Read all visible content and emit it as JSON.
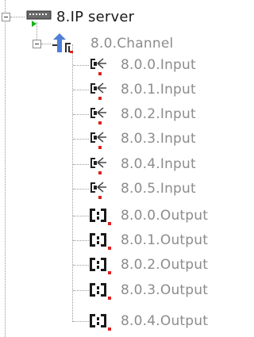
{
  "tree": {
    "server": {
      "label": "8.IP server",
      "icon": "network-server-icon"
    },
    "channel": {
      "label": "8.0.Channel",
      "icon": "channel-antenna-icon"
    },
    "items": [
      {
        "label": "8.0.0.Input",
        "icon": "input-connector-icon"
      },
      {
        "label": "8.0.1.Input",
        "icon": "input-connector-icon"
      },
      {
        "label": "8.0.2.Input",
        "icon": "input-connector-icon"
      },
      {
        "label": "8.0.3.Input",
        "icon": "input-connector-icon"
      },
      {
        "label": "8.0.4.Input",
        "icon": "input-connector-icon"
      },
      {
        "label": "8.0.5.Input",
        "icon": "input-connector-icon"
      },
      {
        "label": "8.0.0.Output",
        "icon": "output-bracket-icon"
      },
      {
        "label": "8.0.1.Output",
        "icon": "output-bracket-icon"
      },
      {
        "label": "8.0.2.Output",
        "icon": "output-bracket-icon"
      },
      {
        "label": "8.0.3.Output",
        "icon": "output-bracket-icon"
      },
      {
        "label": "8.0.4.Output",
        "icon": "output-bracket-icon"
      }
    ]
  },
  "colors": {
    "root_text": "#1a1a1a",
    "dim_text": "#8c8c8c",
    "status_red": "#e02020",
    "status_green": "#16b316",
    "channel_blue": "#4f7fd6"
  }
}
